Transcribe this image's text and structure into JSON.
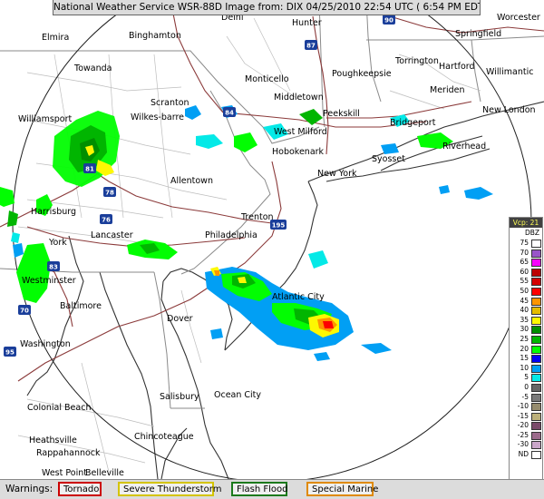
{
  "header": {
    "title": "National Weather Service WSR-88D Image from: DIX 04/25/2010 22:54 UTC ( 6:54 PM EDT)"
  },
  "map": {
    "background": "#ffffff",
    "state_line_color": "#8a8a8a",
    "county_line_color": "#b8b8b8",
    "coast_color": "#333333",
    "highway_color": "#8b3a3a",
    "range_ring_color": "#202020",
    "cities": [
      {
        "name": "Delhi"
      },
      {
        "name": "Hunter"
      },
      {
        "name": "Worcester"
      },
      {
        "name": "Elmira"
      },
      {
        "name": "Binghamton"
      },
      {
        "name": "Springfield"
      },
      {
        "name": "Torrington"
      },
      {
        "name": "Towanda"
      },
      {
        "name": "Monticello"
      },
      {
        "name": "Poughkeepsie"
      },
      {
        "name": "Hartford"
      },
      {
        "name": "Willimantic"
      },
      {
        "name": "Meriden"
      },
      {
        "name": "Middletown"
      },
      {
        "name": "Scranton"
      },
      {
        "name": "Williamsport"
      },
      {
        "name": "Wilkes-barre"
      },
      {
        "name": "Peekskill"
      },
      {
        "name": "New London"
      },
      {
        "name": "Bridgeport"
      },
      {
        "name": "West Milford"
      },
      {
        "name": "Riverhead"
      },
      {
        "name": "Hobokenark"
      },
      {
        "name": "New York"
      },
      {
        "name": "Syosset"
      },
      {
        "name": "Allentown"
      },
      {
        "name": "Harrisburg"
      },
      {
        "name": "Trenton"
      },
      {
        "name": "York"
      },
      {
        "name": "Lancaster"
      },
      {
        "name": "Philadelphia"
      },
      {
        "name": "Westminster"
      },
      {
        "name": "Atlantic City"
      },
      {
        "name": "Baltimore"
      },
      {
        "name": "Dover"
      },
      {
        "name": "Washington"
      },
      {
        "name": "Salisbury"
      },
      {
        "name": "Ocean City"
      },
      {
        "name": "Colonial Beach"
      },
      {
        "name": "Chincoteague"
      },
      {
        "name": "Heathsville"
      },
      {
        "name": "Rappahannock"
      },
      {
        "name": "West Point"
      },
      {
        "name": "Belleville"
      }
    ],
    "highway_shields": [
      "88",
      "90",
      "87",
      "84",
      "81",
      "78",
      "76",
      "195",
      "83",
      "70",
      "95"
    ]
  },
  "legend": {
    "mode": "Vcp: 21",
    "unit": "DBZ",
    "rows": [
      {
        "label": "75",
        "color": "#ffffff"
      },
      {
        "label": "70",
        "color": "#9954c9"
      },
      {
        "label": "65",
        "color": "#f800fd"
      },
      {
        "label": "60",
        "color": "#bc0000"
      },
      {
        "label": "55",
        "color": "#d40000"
      },
      {
        "label": "50",
        "color": "#fd0000"
      },
      {
        "label": "45",
        "color": "#fd9500"
      },
      {
        "label": "40",
        "color": "#e5bc00"
      },
      {
        "label": "35",
        "color": "#fdf802"
      },
      {
        "label": "30",
        "color": "#008e00"
      },
      {
        "label": "25",
        "color": "#01b501"
      },
      {
        "label": "20",
        "color": "#02fd02"
      },
      {
        "label": "15",
        "color": "#0300f4"
      },
      {
        "label": "10",
        "color": "#019ff4"
      },
      {
        "label": "5",
        "color": "#04e9e7"
      },
      {
        "label": "0",
        "color": "#666666"
      },
      {
        "label": "-5",
        "color": "#7a7a7a"
      },
      {
        "label": "-10",
        "color": "#968c6e"
      },
      {
        "label": "-15",
        "color": "#bcb07a"
      },
      {
        "label": "-20",
        "color": "#7a4a6a"
      },
      {
        "label": "-25",
        "color": "#9c6b8c"
      },
      {
        "label": "-30",
        "color": "#caa6c9"
      },
      {
        "label": "ND",
        "color": "#ffffff"
      }
    ]
  },
  "warnings": {
    "label": "Warnings:",
    "items": [
      {
        "label": "Tornado",
        "color": "#cc0000"
      },
      {
        "label": "Severe Thunderstorm",
        "color": "#d4c400"
      },
      {
        "label": "Flash Flood",
        "color": "#1c7a1c"
      },
      {
        "label": "Special Marine",
        "color": "#e08a00"
      }
    ]
  }
}
